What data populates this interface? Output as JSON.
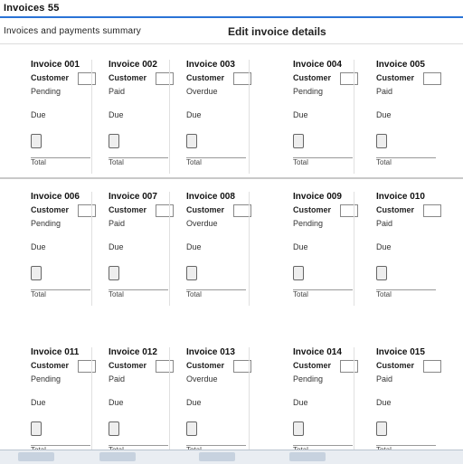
{
  "window": {
    "title": "Invoices 55",
    "header_left": "Invoices and payments summary",
    "header_right": "Edit invoice details"
  },
  "cards": [
    {
      "t1": "Invoice 001",
      "t2": "Customer",
      "t3": "Pending",
      "t4": "Due",
      "footer": "Total"
    },
    {
      "t1": "Invoice 002",
      "t2": "Customer",
      "t3": "Paid",
      "t4": "Due",
      "footer": "Total"
    },
    {
      "t1": "Invoice 003",
      "t2": "Customer",
      "t3": "Overdue",
      "t4": "Due",
      "footer": "Total"
    },
    {
      "t1": "Invoice 004",
      "t2": "Customer",
      "t3": "Pending",
      "t4": "Due",
      "footer": "Total"
    },
    {
      "t1": "Invoice 005",
      "t2": "Customer",
      "t3": "Paid",
      "t4": "Due",
      "footer": "Total"
    },
    {
      "t1": "Invoice 006",
      "t2": "Customer",
      "t3": "Pending",
      "t4": "Due",
      "footer": "Total"
    },
    {
      "t1": "Invoice 007",
      "t2": "Customer",
      "t3": "Paid",
      "t4": "Due",
      "footer": "Total"
    },
    {
      "t1": "Invoice 008",
      "t2": "Customer",
      "t3": "Overdue",
      "t4": "Due",
      "footer": "Total"
    },
    {
      "t1": "Invoice 009",
      "t2": "Customer",
      "t3": "Pending",
      "t4": "Due",
      "footer": "Total"
    },
    {
      "t1": "Invoice 010",
      "t2": "Customer",
      "t3": "Paid",
      "t4": "Due",
      "footer": "Total"
    },
    {
      "t1": "Invoice 011",
      "t2": "Customer",
      "t3": "Pending",
      "t4": "Due",
      "footer": "Total"
    },
    {
      "t1": "Invoice 012",
      "t2": "Customer",
      "t3": "Paid",
      "t4": "Due",
      "footer": "Total"
    },
    {
      "t1": "Invoice 013",
      "t2": "Customer",
      "t3": "Overdue",
      "t4": "Due",
      "footer": "Total"
    },
    {
      "t1": "Invoice 014",
      "t2": "Customer",
      "t3": "Pending",
      "t4": "Due",
      "footer": "Total"
    },
    {
      "t1": "Invoice 015",
      "t2": "Customer",
      "t3": "Paid",
      "t4": "Due",
      "footer": "Total"
    }
  ]
}
